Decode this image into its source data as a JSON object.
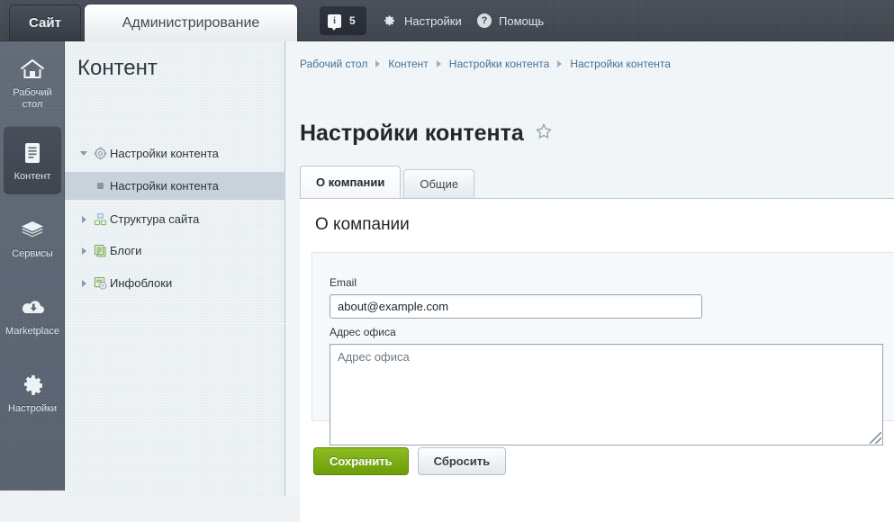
{
  "header": {
    "site_tab": "Сайт",
    "admin_tab": "Администрирование",
    "info_icon": "info-bubble-icon",
    "info_count": "5",
    "settings_label": "Настройки",
    "settings_icon": "gear-icon",
    "help_label": "Помощь",
    "help_icon": "question-circle-icon"
  },
  "rail": {
    "items": [
      {
        "label": "Рабочий стол",
        "icon": "home-icon",
        "active": false
      },
      {
        "label": "Контент",
        "icon": "document-icon",
        "active": true
      },
      {
        "label": "Сервисы",
        "icon": "layers-icon",
        "active": false
      },
      {
        "label": "Marketplace",
        "icon": "cloud-download-icon",
        "active": false
      },
      {
        "label": "Настройки",
        "icon": "gear-icon",
        "active": false
      }
    ]
  },
  "tree": {
    "title": "Контент",
    "items": [
      {
        "label": "Настройки контента",
        "icon": "gear-gray-icon",
        "expanded": true,
        "selected": false
      },
      {
        "label": "Настройки контента",
        "icon": "bullet-icon",
        "expanded": false,
        "selected": true
      },
      {
        "label": "Структура сайта",
        "icon": "sitemap-icon",
        "expanded": false,
        "selected": false
      },
      {
        "label": "Блоги",
        "icon": "pages-green-icon",
        "expanded": false,
        "selected": false
      },
      {
        "label": "Инфоблоки",
        "icon": "infoblock-icon",
        "expanded": false,
        "selected": false
      }
    ]
  },
  "main": {
    "breadcrumbs": [
      "Рабочий стол",
      "Контент",
      "Настройки контента",
      "Настройки контента"
    ],
    "page_title": "Настройки контента",
    "favorite_icon": "star-outline-icon",
    "tabs": [
      {
        "label": "О компании",
        "active": true
      },
      {
        "label": "Общие",
        "active": false
      }
    ],
    "panel_heading": "О компании",
    "fields": {
      "email_label": "Email",
      "email_value": "about@example.com",
      "address_label": "Адрес офиса",
      "address_value": "",
      "address_placeholder": "Адрес офиса"
    },
    "save_label": "Сохранить",
    "reset_label": "Сбросить"
  },
  "colors": {
    "header_bg": "#464e58",
    "rail_bg": "#5d6673",
    "tree_bg": "#e7eef1",
    "tree_selected": "#c7d2da",
    "save_green": "#7cae14",
    "link_blue": "#4a6f94"
  }
}
